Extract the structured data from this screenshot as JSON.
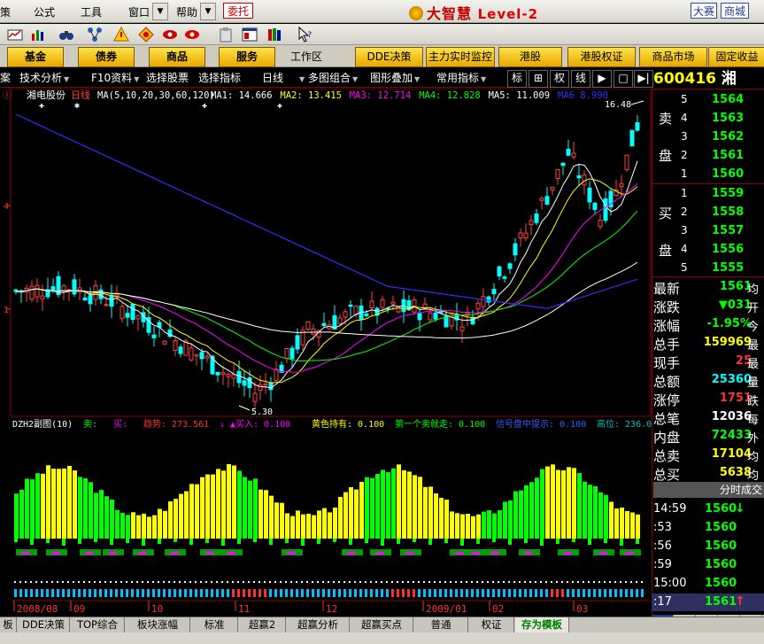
{
  "menu": {
    "items": [
      "策",
      "公式",
      "工具",
      "窗口",
      "帮助"
    ],
    "weituo": "委托",
    "brand": "大智慧",
    "brand_level": "Level-2",
    "right_tabs": [
      "大赛",
      "商城"
    ]
  },
  "buttons": [
    "基金",
    "债券",
    "商品",
    "服务"
  ],
  "workarea_label": "工作区",
  "buttons2": [
    "DDE决策",
    "主力实时监控",
    "港股",
    "港股权证",
    "商品市场",
    "固定收益"
  ],
  "chart_toolbar": {
    "items": [
      "案",
      "技术分析",
      "F10资料",
      "选择股票",
      "选择指标",
      "日线",
      "多图组合",
      "图形叠加",
      "常用指标"
    ],
    "right": [
      "标",
      "⊞",
      "权",
      "线",
      "▶",
      "□",
      "▶|"
    ]
  },
  "stock": {
    "code": "600416",
    "name": "湘",
    "title_name": "湘电股份",
    "period": "日线",
    "ma_label": "MA(5,10,20,30,60,120)",
    "ma_values": [
      {
        "label": "MA1:",
        "value": "14.666",
        "color": "#ffffff"
      },
      {
        "label": "MA2:",
        "value": "13.415",
        "color": "#ffff00"
      },
      {
        "label": "MA3:",
        "value": "12.714",
        "color": "#ff00ff"
      },
      {
        "label": "MA4:",
        "value": "12.828",
        "color": "#00ff00"
      },
      {
        "label": "MA5:",
        "value": "11.009",
        "color": "#ffffff"
      },
      {
        "label": "MA6",
        "value": "8.990",
        "color": "#3030ff"
      }
    ],
    "high_label": "16.48",
    "low_label": "5.30",
    "y_axis_ticks": [
      "4",
      "1"
    ]
  },
  "sub_indicator": {
    "name": "DZH2副图(10)",
    "items": [
      {
        "label": "卖:",
        "value": "",
        "color": "#00ff00"
      },
      {
        "label": "买:",
        "value": "",
        "color": "#ff00ff"
      },
      {
        "label": "趋势:",
        "value": "273.561",
        "color": "#ff3030"
      },
      {
        "label": "↓ ▲买入:",
        "value": "0.100",
        "color": "#ff00ff"
      },
      {
        "label": "黄色持有:",
        "value": "0.100",
        "color": "#ffff00"
      },
      {
        "label": "第一个卖就走:",
        "value": "0.100",
        "color": "#00ff00"
      },
      {
        "label": "信号盘中提示:",
        "value": "0.100",
        "color": "#3060ff"
      },
      {
        "label": "高位:",
        "value": "236.00",
        "color": "#00c0c0"
      }
    ]
  },
  "x_axis": [
    "2008/08",
    "09",
    "10",
    "11",
    "12",
    "2009/01",
    "02",
    "03"
  ],
  "quote": {
    "sell_label": [
      "卖",
      "盘"
    ],
    "buy_label": [
      "买",
      "盘"
    ],
    "sell": [
      {
        "level": "5",
        "price": "1564"
      },
      {
        "level": "4",
        "price": "1563"
      },
      {
        "level": "3",
        "price": "1562"
      },
      {
        "level": "2",
        "price": "1561"
      },
      {
        "level": "1",
        "price": "1560"
      }
    ],
    "buy": [
      {
        "level": "1",
        "price": "1559"
      },
      {
        "level": "2",
        "price": "1558"
      },
      {
        "level": "3",
        "price": "1557"
      },
      {
        "level": "4",
        "price": "1556"
      },
      {
        "level": "5",
        "price": "1555"
      }
    ],
    "stats": [
      {
        "label": "最新",
        "value": "1561",
        "tail": "均",
        "color": "#00ff00"
      },
      {
        "label": "涨跌",
        "value": "▼031",
        "tail": "开",
        "color": "#00ff00"
      },
      {
        "label": "涨幅",
        "value": "-1.95%",
        "tail": "今",
        "color": "#00ff00"
      },
      {
        "label": "总手",
        "value": "159969",
        "tail": "最",
        "color": "#ffff00"
      },
      {
        "label": "现手",
        "value": "25",
        "tail": "最",
        "color": "#ff3030"
      },
      {
        "label": "总额",
        "value": "25360",
        "tail": "量",
        "color": "#00ffff"
      },
      {
        "label": "涨停",
        "value": "1751",
        "tail": "跌",
        "color": "#ff3030"
      },
      {
        "label": "总笔",
        "value": "12036",
        "tail": "每",
        "color": "#ffffff"
      },
      {
        "label": "内盘",
        "value": "72433",
        "tail": "外",
        "color": "#00ff00"
      },
      {
        "label": "总卖",
        "value": "17104",
        "tail": "均",
        "color": "#ffff00"
      },
      {
        "label": "总买",
        "value": "5638",
        "tail": "均",
        "color": "#ffff00"
      }
    ],
    "ticks_title": "分时成交",
    "ticks": [
      {
        "time": "14:59",
        "price": "1560",
        "arrow": "↓",
        "arrow_color": "#00ff00"
      },
      {
        "time": ":53",
        "price": "1560",
        "arrow": "",
        "arrow_color": ""
      },
      {
        "time": ":56",
        "price": "1560",
        "arrow": "",
        "arrow_color": ""
      },
      {
        "time": ":59",
        "price": "1560",
        "arrow": "",
        "arrow_color": ""
      },
      {
        "time": "15:00",
        "price": "1560",
        "arrow": "",
        "arrow_color": ""
      },
      {
        "time": ":17",
        "price": "1561",
        "arrow": "↑",
        "arrow_color": "#ff3030"
      }
    ],
    "bottom_tabs": [
      "细",
      "财",
      "价",
      "指",
      "多"
    ]
  },
  "bottom_tabs": [
    "板",
    "DDE决策",
    "TOP综合",
    "板块涨幅",
    "标准",
    "超赢2",
    "超赢分析",
    "超赢买点",
    "普通",
    "权证",
    "存为模板"
  ],
  "active_bottom_tab": "存为模板",
  "colors": {
    "up": "#ff4040",
    "down": "#00ffff",
    "ma5": "#ffffff",
    "ma10": "#ffff00",
    "ma20": "#ff00ff",
    "ma30": "#00ff00",
    "ma60": "#ffffff",
    "ma120": "#3030ff"
  }
}
